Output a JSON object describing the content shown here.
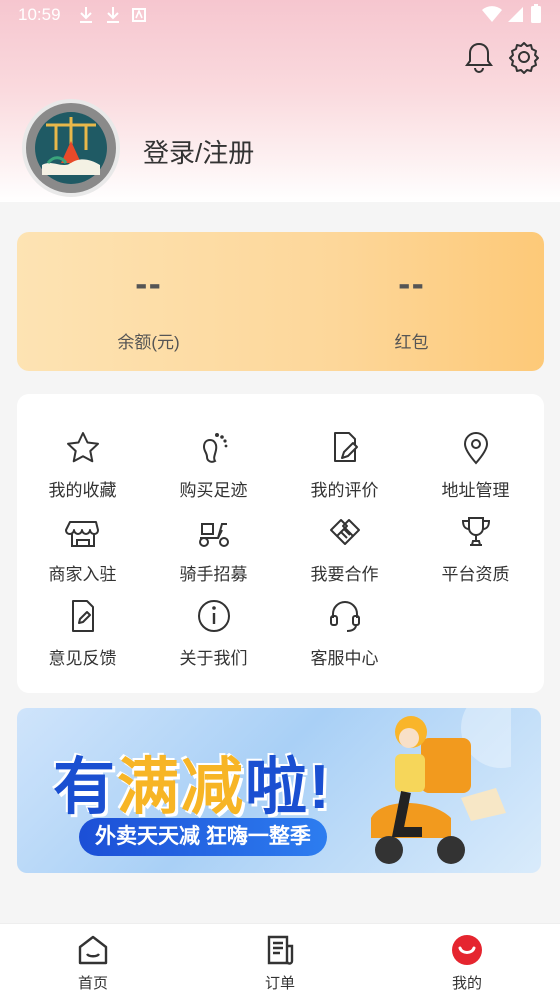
{
  "status_bar": {
    "time": "10:59"
  },
  "header": {
    "login_text": "登录/注册"
  },
  "wallet": [
    {
      "value": "--",
      "label": "余额(元)"
    },
    {
      "value": "--",
      "label": "红包"
    }
  ],
  "menu": {
    "items": [
      {
        "label": "我的收藏",
        "icon": "star-icon"
      },
      {
        "label": "购买足迹",
        "icon": "footprint-icon"
      },
      {
        "label": "我的评价",
        "icon": "edit-document-icon"
      },
      {
        "label": "地址管理",
        "icon": "location-pin-icon"
      },
      {
        "label": "商家入驻",
        "icon": "shop-icon"
      },
      {
        "label": "骑手招募",
        "icon": "scooter-icon"
      },
      {
        "label": "我要合作",
        "icon": "handshake-icon"
      },
      {
        "label": "平台资质",
        "icon": "trophy-icon"
      },
      {
        "label": "意见反馈",
        "icon": "feedback-document-icon"
      },
      {
        "label": "关于我们",
        "icon": "info-icon"
      },
      {
        "label": "客服中心",
        "icon": "headset-icon"
      }
    ]
  },
  "banner": {
    "title_1": "有",
    "title_2": "满减",
    "title_3": "啦!",
    "subtitle": "外卖天天减 狂嗨一整季"
  },
  "tabbar": [
    {
      "label": "首页",
      "icon": "home-icon",
      "active": false
    },
    {
      "label": "订单",
      "icon": "orders-icon",
      "active": false
    },
    {
      "label": "我的",
      "icon": "profile-icon",
      "active": true
    }
  ],
  "colors": {
    "accent": "#e5252f",
    "wallet_gradient_start": "#fde3b3",
    "wallet_gradient_end": "#fdc978"
  }
}
